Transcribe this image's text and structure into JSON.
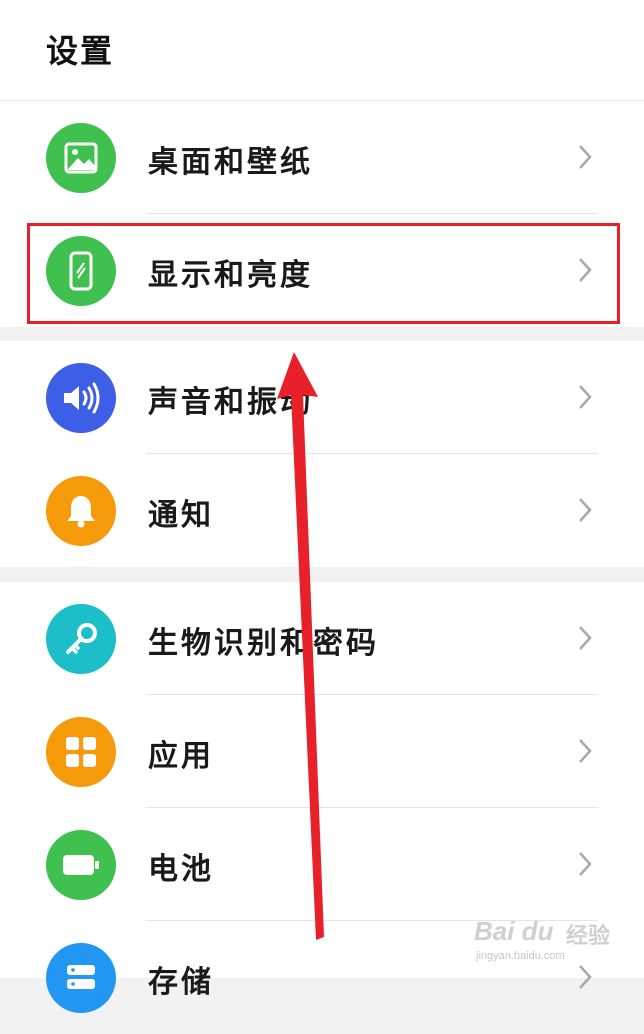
{
  "header": {
    "title": "设置"
  },
  "groups": [
    {
      "items": [
        {
          "label": "桌面和壁纸",
          "icon": "wallpaper-image-icon",
          "color": "#3fc04f"
        },
        {
          "label": "显示和亮度",
          "icon": "display-phone-icon",
          "color": "#3fc04f"
        }
      ]
    },
    {
      "items": [
        {
          "label": "声音和振动",
          "icon": "speaker-icon",
          "color": "#3d5ee6"
        },
        {
          "label": "通知",
          "icon": "bell-icon",
          "color": "#f59b0a"
        }
      ]
    },
    {
      "items": [
        {
          "label": "生物识别和密码",
          "icon": "key-icon",
          "color": "#1cbfc8"
        },
        {
          "label": "应用",
          "icon": "apps-grid-icon",
          "color": "#f59b0a"
        },
        {
          "label": "电池",
          "icon": "battery-icon",
          "color": "#3fc04f"
        },
        {
          "label": "存储",
          "icon": "storage-icon",
          "color": "#2196f3"
        }
      ]
    }
  ],
  "annotations": {
    "highlight_color": "#e8202a",
    "arrow_color": "#e8202a"
  },
  "watermark": {
    "brand": "Bai du",
    "brand_cn": "经验",
    "url": "jingyan.baidu.com"
  }
}
